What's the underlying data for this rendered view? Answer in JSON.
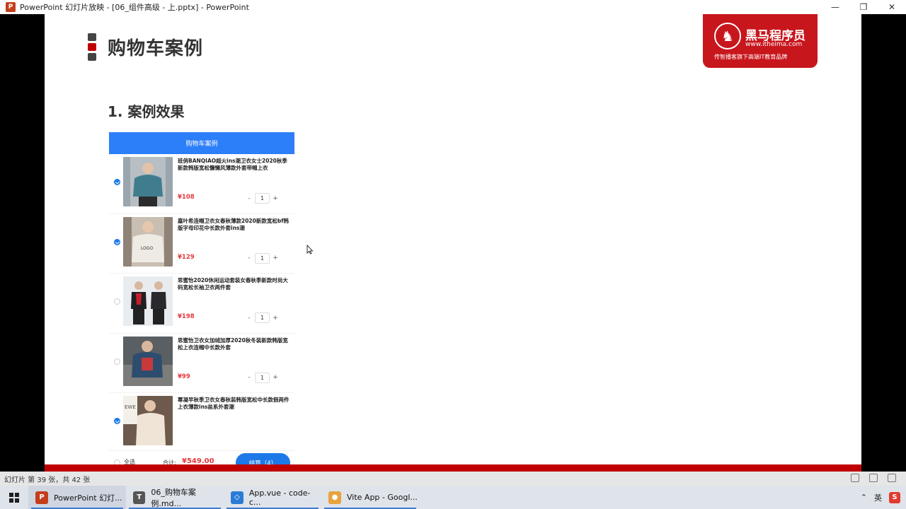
{
  "window": {
    "title": "PowerPoint 幻灯片放映 - [06_组件高级 - 上.pptx] - PowerPoint",
    "app_icon": "P",
    "minimize": "—",
    "restore": "❐",
    "close": "✕"
  },
  "slide": {
    "title": "购物车案例",
    "section": "1. 案例效果",
    "logo": {
      "brand": "黑马程序员",
      "url": "www.itheima.com",
      "tagline": "传智播客旗下高端IT教育品牌"
    }
  },
  "cart": {
    "header": "购物车案例",
    "items": [
      {
        "name": "班俏BANQIAO超火ins潮卫衣女士2020秋季新款韩版宽松慵懒风薄款外套带帽上衣",
        "price": "¥108",
        "qty": "1",
        "checked": true
      },
      {
        "name": "嘉叶希连帽卫衣女春秋薄款2020新款宽松bf韩版字母印花中长款外套ins潮",
        "price": "¥129",
        "qty": "1",
        "checked": true
      },
      {
        "name": "思蜜怡2020休闲运动套装女春秋季新款时尚大码宽松长袖卫衣两件套",
        "price": "¥198",
        "qty": "1",
        "checked": false
      },
      {
        "name": "思蜜怡卫衣女加绒加厚2020秋冬装新款韩版宽松上衣连帽中长款外套",
        "price": "¥99",
        "qty": "1",
        "checked": false
      },
      {
        "name": "幂凝早秋季卫衣女春秋装韩版宽松中长款假两件上衣薄款ins盐系外套潮",
        "price": "",
        "qty": "",
        "checked": true
      }
    ],
    "stepper": {
      "minus": "-",
      "plus": "+"
    },
    "footer": {
      "select_all": "全选",
      "total_label": "合计:",
      "total": "¥549.00",
      "checkout": "结算（4）"
    }
  },
  "statusbar": {
    "text": "幻灯片 第 39 张，共 42 张"
  },
  "taskbar": {
    "apps": [
      {
        "label": "PowerPoint 幻灯...",
        "icon": "P",
        "color": "#c43e1c"
      },
      {
        "label": "06_购物车案例.md...",
        "icon": "T",
        "color": "#555555"
      },
      {
        "label": "App.vue - code-c...",
        "icon": "◇",
        "color": "#2b7bd6"
      },
      {
        "label": "Vite App - Googl...",
        "icon": "●",
        "color": "#e8a33d"
      }
    ],
    "tray": {
      "chevron": "⌃",
      "ime": "英"
    }
  }
}
